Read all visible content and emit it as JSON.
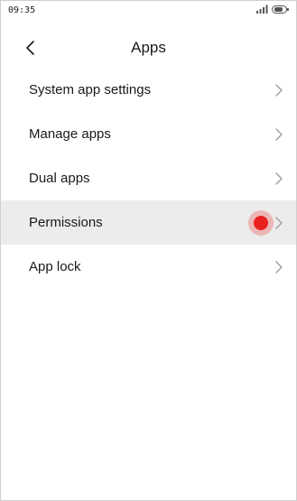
{
  "status_bar": {
    "time": "09:35",
    "signal_icon": "signal-icon",
    "battery_icon": "battery-icon"
  },
  "header": {
    "back_icon": "back-arrow-icon",
    "title": "Apps"
  },
  "menu": {
    "items": [
      {
        "label": "System app settings",
        "icon": "chevron-right-icon"
      },
      {
        "label": "Manage apps",
        "icon": "chevron-right-icon"
      },
      {
        "label": "Dual apps",
        "icon": "chevron-right-icon"
      },
      {
        "label": "Permissions",
        "icon": "chevron-right-icon",
        "pressed": true
      },
      {
        "label": "App lock",
        "icon": "chevron-right-icon"
      }
    ]
  },
  "colors": {
    "pressed_background": "#ececec",
    "touch_indicator": "#e8201e",
    "text": "#1a1a1a",
    "chevron": "#9a9a9a"
  }
}
